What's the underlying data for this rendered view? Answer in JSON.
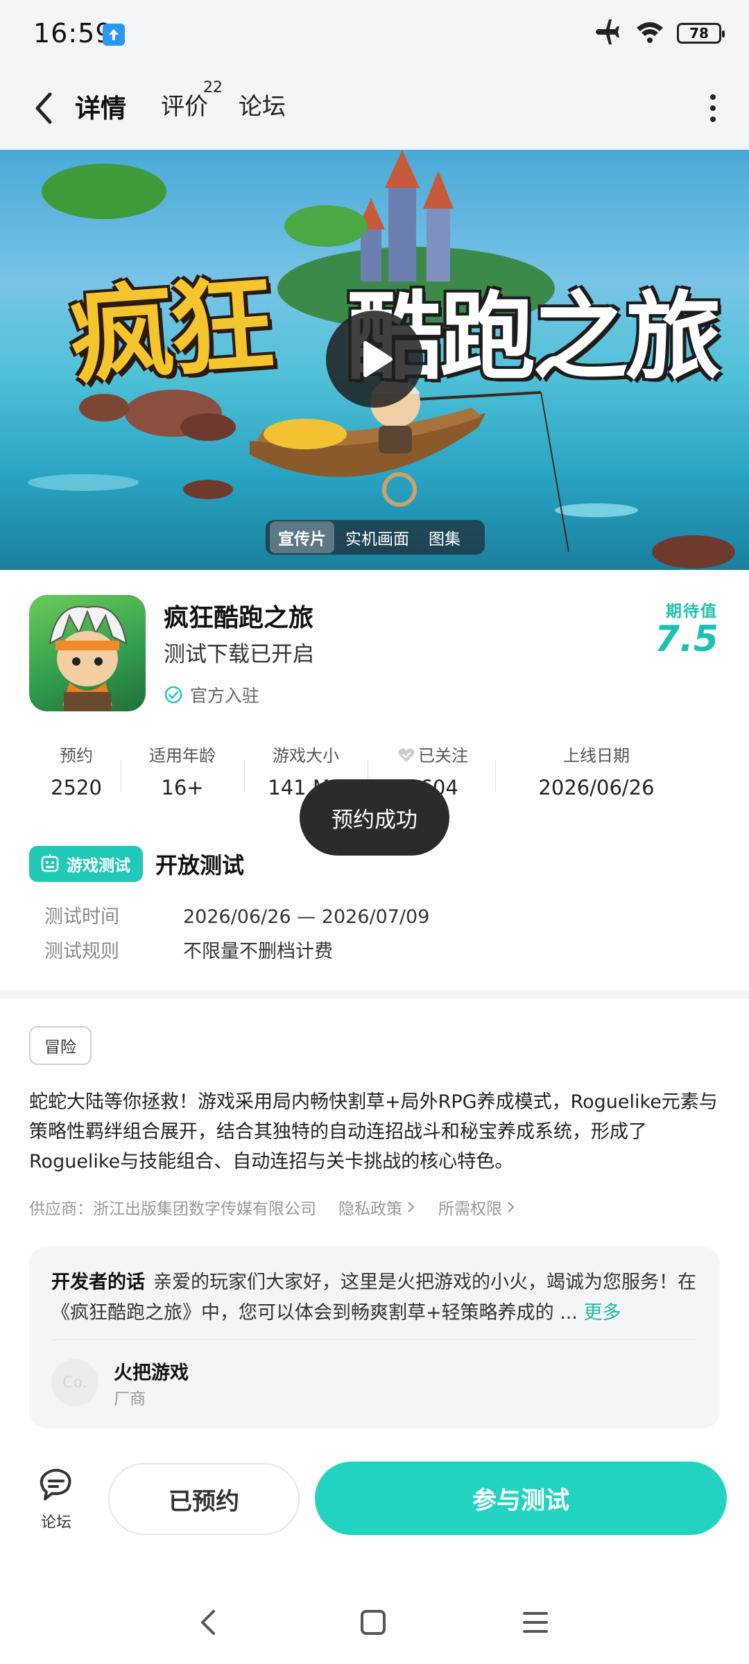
{
  "status_bar": {
    "time": "16:59",
    "battery": "78",
    "icons": [
      "upload-badge-icon",
      "airplane-icon",
      "wifi-icon",
      "battery-icon"
    ]
  },
  "nav": {
    "tabs": [
      {
        "label": "详情",
        "active": true
      },
      {
        "label": "评价",
        "badge": "22"
      },
      {
        "label": "论坛"
      }
    ],
    "icons": [
      "back-arrow-icon",
      "more-vertical-icon"
    ]
  },
  "banner": {
    "title_left": "疯狂",
    "title_right": "酷跑之旅",
    "media_tabs": [
      {
        "label": "宣传片",
        "active": true
      },
      {
        "label": "实机画面"
      },
      {
        "label": "图集"
      }
    ]
  },
  "game": {
    "name": "疯狂酷跑之旅",
    "status": "测试下载已开启",
    "official": "官方入驻",
    "expectation_label": "期待值",
    "expectation_value": "7.5"
  },
  "stats": [
    {
      "label": "预约",
      "value": "2520"
    },
    {
      "label": "适用年龄",
      "value": "16+"
    },
    {
      "label": "游戏大小",
      "value": "141 MB"
    },
    {
      "label": "已关注",
      "value": "3604"
    },
    {
      "label": "上线日期",
      "value": "2026/06/26"
    }
  ],
  "toast": "预约成功",
  "test": {
    "badge": "游戏测试",
    "title": "开放测试",
    "time_label": "测试时间",
    "time_value": "2026/06/26 — 2026/07/09",
    "rule_label": "测试规则",
    "rule_value": "不限量不删档计费"
  },
  "genre_tag": "冒险",
  "description": "蛇蛇大陆等你拯救！游戏采用局内畅快割草+局外RPG养成模式，Roguelike元素与策略性羁绊组合展开，结合其独特的自动连招战斗和秘宝养成系统，形成了Roguelike与技能组合、自动连招与关卡挑战的核心特色。",
  "meta": {
    "supplier": "供应商：浙江出版集团数字传媒有限公司",
    "privacy": "隐私政策",
    "permissions": "所需权限"
  },
  "developer": {
    "lead": "开发者的话",
    "text": "亲爱的玩家们大家好，这里是火把游戏的小火，竭诚为您服务！在《疯狂酷跑之旅》中，您可以体会到畅爽割草+轻策略养成的 ...",
    "more": "更多",
    "avatar_text": "Co.",
    "name": "火把游戏",
    "role": "厂商"
  },
  "actions": {
    "forum": "论坛",
    "reserved": "已预约",
    "join_test": "参与测试"
  },
  "colors": {
    "accent": "#22d3c2",
    "expect": "#1fc0b1",
    "toast_bg": "#2b2b2b"
  }
}
